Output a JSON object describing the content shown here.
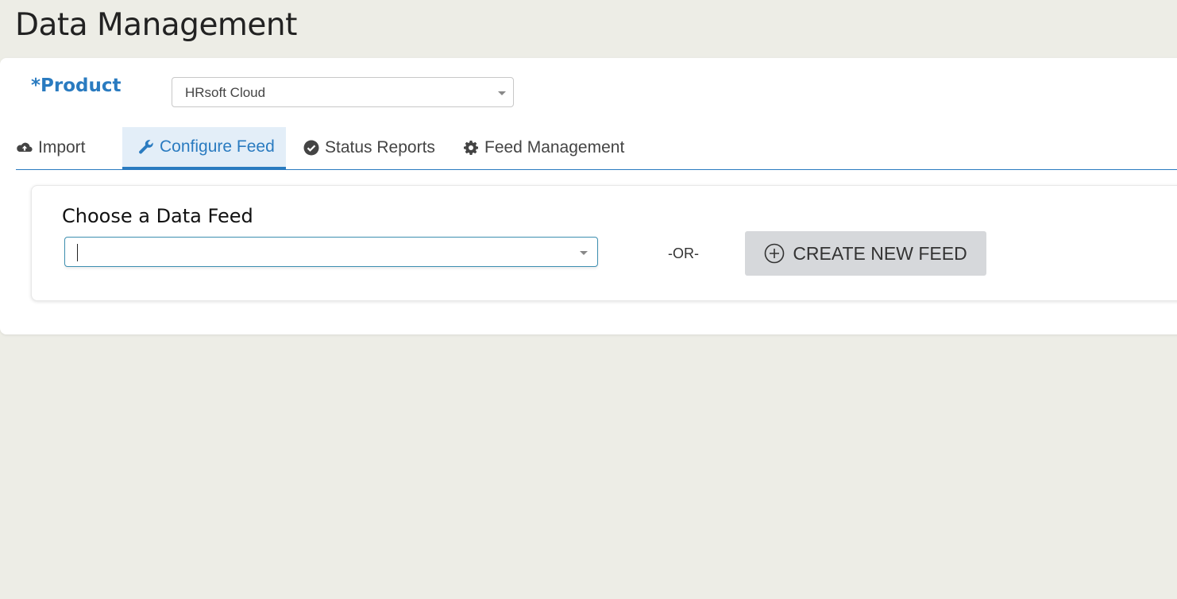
{
  "page": {
    "title": "Data Management"
  },
  "product": {
    "label": "*Product",
    "selected": "HRsoft Cloud"
  },
  "tabs": [
    {
      "label": "Import",
      "icon": "cloud-upload-icon",
      "active": false
    },
    {
      "label": "Configure Feed",
      "icon": "wrench-icon",
      "active": true
    },
    {
      "label": "Status Reports",
      "icon": "check-circle-icon",
      "active": false
    },
    {
      "label": "Feed Management",
      "icon": "gear-icon",
      "active": false
    }
  ],
  "configure": {
    "heading": "Choose a Data Feed",
    "feed_value": "",
    "or_text": "-OR-",
    "create_button": "CREATE NEW FEED"
  },
  "colors": {
    "accent": "#2a7bc0",
    "background": "#edede6",
    "button_bg": "#d6d8db"
  }
}
